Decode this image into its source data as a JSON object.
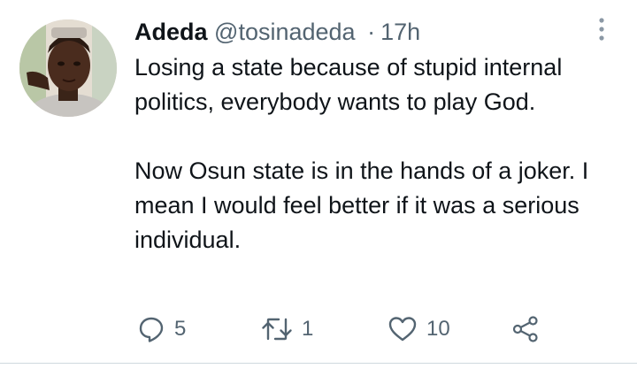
{
  "tweet": {
    "author_name": "Adeda",
    "handle": "@tosinadeda",
    "separator": "·",
    "time": "17h",
    "text_paragraphs": [
      "Losing a state because of stupid internal politics, everybody wants to play God.",
      "Now Osun state is in the hands of a joker. I mean I would feel better if it was a serious individual."
    ],
    "actions": {
      "reply_count": "5",
      "retweet_count": "1",
      "like_count": "10"
    }
  },
  "icons": {
    "more": "more-vertical-icon",
    "reply": "reply-icon",
    "retweet": "retweet-icon",
    "like": "heart-icon",
    "share": "share-icon"
  },
  "colors": {
    "text": "#0f1419",
    "secondary": "#536471",
    "divider": "#cfd9de",
    "background": "#ffffff"
  }
}
